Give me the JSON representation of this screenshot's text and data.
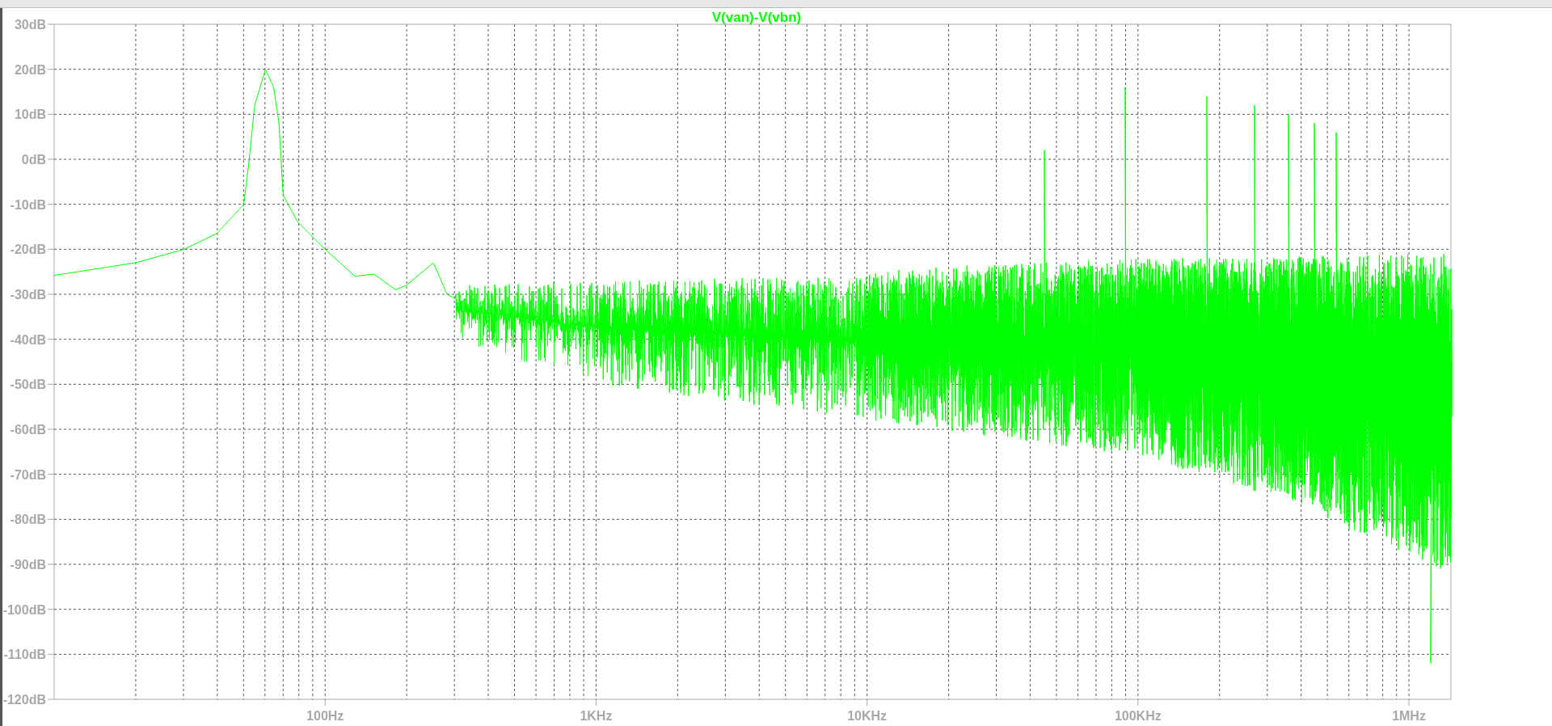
{
  "plot": {
    "trace": {
      "name": "V(van)-V(vbn)",
      "color": "#00ff00"
    },
    "y_axis_labels": [
      "30dB",
      "20dB",
      "10dB",
      "0dB",
      "-10dB",
      "-20dB",
      "-30dB",
      "-40dB",
      "-50dB",
      "-60dB",
      "-70dB",
      "-80dB",
      "-90dB",
      "-100dB",
      "-110dB",
      "-120dB"
    ],
    "x_axis_labels": [
      "100Hz",
      "1KHz",
      "10KHz",
      "100KHz",
      "1MHz"
    ]
  }
}
